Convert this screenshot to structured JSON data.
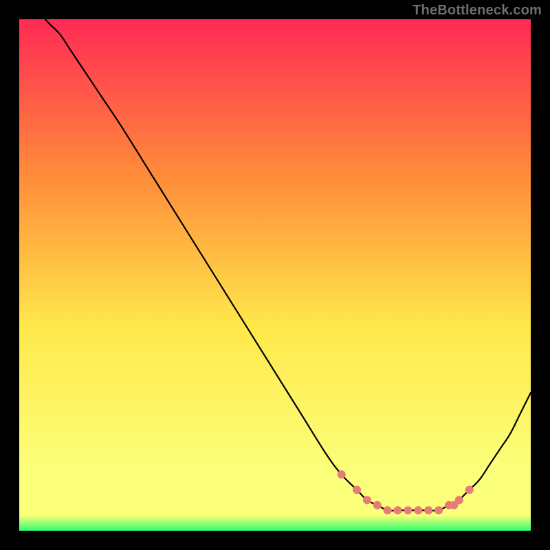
{
  "watermark": "TheBottleneck.com",
  "chart_data": {
    "type": "line",
    "title": "",
    "xlabel": "",
    "ylabel": "",
    "xlim": [
      0,
      100
    ],
    "ylim": [
      0,
      100
    ],
    "grid": false,
    "legend": false,
    "gradient_colors": {
      "top": "#ff2a55",
      "mid_upper": "#ff8a3a",
      "mid": "#ffe84a",
      "mid_lower": "#fcff7a",
      "bottom": "#2bff71"
    },
    "series": [
      {
        "name": "bottleneck-curve",
        "x": [
          0,
          2,
          4,
          6,
          8,
          10,
          12,
          16,
          20,
          25,
          30,
          35,
          40,
          45,
          50,
          55,
          60,
          63,
          66,
          68,
          70,
          72,
          74,
          76,
          78,
          80,
          82,
          84,
          85,
          86,
          88,
          90,
          92,
          94,
          96,
          98,
          100
        ],
        "y": [
          103,
          102,
          101,
          99,
          97,
          94,
          91,
          85,
          79,
          71,
          63,
          55,
          47,
          39,
          31,
          23,
          15,
          11,
          8,
          6,
          5,
          4,
          4,
          4,
          4,
          4,
          4,
          5,
          5,
          6,
          8,
          10,
          13,
          16,
          19,
          23,
          27
        ],
        "color": "#000000",
        "width": 2.2,
        "fill": false
      },
      {
        "name": "highlight-dots",
        "type": "scatter",
        "x": [
          63,
          66,
          68,
          70,
          72,
          74,
          76,
          78,
          80,
          82,
          84,
          85,
          86,
          88
        ],
        "y": [
          11,
          8,
          6,
          5,
          4,
          4,
          4,
          4,
          4,
          4,
          5,
          5,
          6,
          8
        ],
        "color": "#e87a78",
        "radius": 6
      }
    ]
  }
}
